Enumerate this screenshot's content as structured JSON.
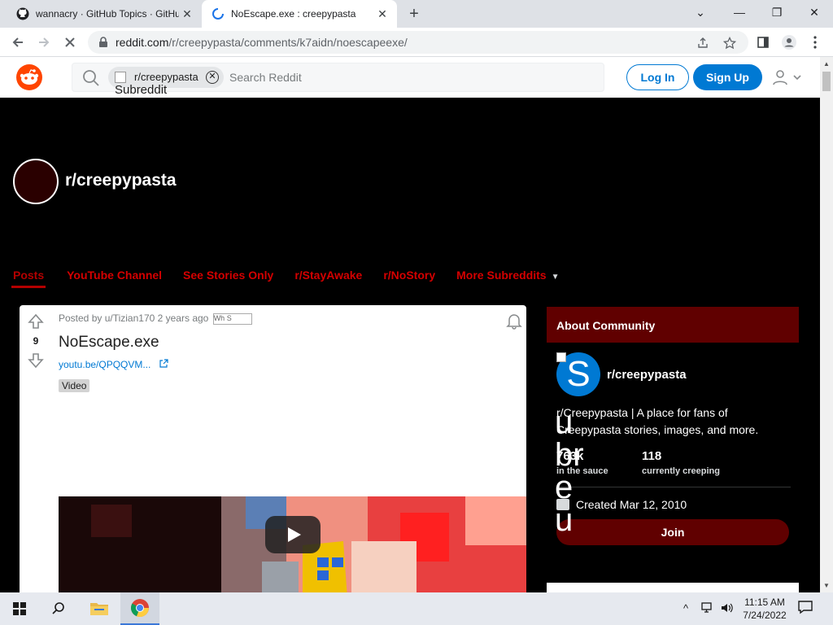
{
  "browser": {
    "tabs": [
      {
        "title": "wannacry · GitHub Topics · GitHub",
        "icon": "github-icon",
        "active": false
      },
      {
        "title": "NoEscape.exe : creepypasta",
        "icon": "loading-spinner-icon",
        "active": true
      }
    ],
    "new_tab": "+",
    "window_controls": {
      "minimize": "—",
      "restore": "❐",
      "close": "✕",
      "tab_search": "⌄"
    },
    "url_host": "reddit.com",
    "url_path": "/r/creepypasta/comments/k7aidn/noescapeexe/"
  },
  "reddit_header": {
    "search_chip_label": "r/creepypasta",
    "search_chip_alt": "Subreddit",
    "search_placeholder": "Search Reddit",
    "login": "Log In",
    "signup": "Sign Up"
  },
  "subreddit": {
    "name": "r/creepypasta",
    "nav": [
      {
        "label": "Posts",
        "active": true
      },
      {
        "label": "YouTube Channel",
        "active": false
      },
      {
        "label": "See Stories Only",
        "active": false
      },
      {
        "label": "r/StayAwake",
        "active": false
      },
      {
        "label": "r/NoStory",
        "active": false
      },
      {
        "label": "More Subreddits",
        "active": false
      }
    ],
    "accent_color": "#d40000"
  },
  "post": {
    "score": "9",
    "meta": "Posted by u/Tizian170 2 years ago",
    "award_alt": "Wh S",
    "title": "NoEscape.exe",
    "link": "youtu.be/QPQQVM...",
    "flair": "Video"
  },
  "about": {
    "header": "About Community",
    "icon_letter": "S",
    "community_name": "r/creepypasta",
    "description": "r/Creepypasta | A place for fans of Creepypasta stories, images, and more.",
    "members_count": "763k",
    "members_label": "in the sauce",
    "online_count": "118",
    "online_label": "currently creeping",
    "created": "Created Mar 12, 2010",
    "join": "Join",
    "overlay_text": "u br e u"
  },
  "taskbar": {
    "time": "11:15 AM",
    "date": "7/24/2022"
  }
}
